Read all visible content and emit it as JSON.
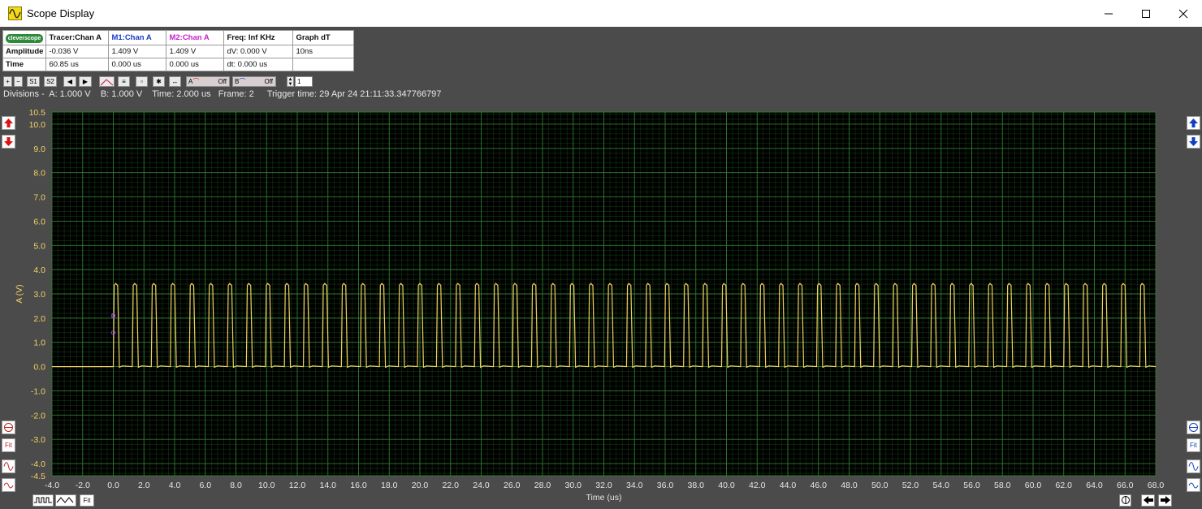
{
  "window": {
    "title": "Scope Display",
    "app_icon": "sine-wave-icon",
    "controls": [
      "minimize-icon",
      "maximize-icon",
      "close-icon"
    ]
  },
  "info_table": {
    "headers": [
      "",
      "Tracer:Chan A",
      "M1:Chan A",
      "M2:Chan A",
      "Freq: Inf KHz",
      "Graph dT"
    ],
    "header_colors": [
      "#000000",
      "#000000",
      "#1a3cc8",
      "#c81ec8",
      "#000000",
      "#000000"
    ],
    "rows": [
      [
        "Amplitude",
        "-0.036 V",
        "1.409 V",
        "1.409 V",
        "dV: 0.000 V",
        "10ns"
      ],
      [
        "Time",
        "60.85 us",
        "0.000 us",
        "0.000 us",
        "dt:  0.000 us",
        ""
      ]
    ],
    "logo_text": "cleverscope"
  },
  "toolbar": {
    "zoom_in": "+",
    "zoom_out": "−",
    "s1": "S1",
    "s2": "S2",
    "chan_a_label": "A",
    "chan_a_state": "Off",
    "chan_b_label": "B",
    "chan_b_state": "Off",
    "frame_value": "1"
  },
  "status_line": {
    "divisions": "Divisions -  A: 1.000 V    B: 1.000 V    Time: 2.000 us   Frame: 2",
    "trigger": "Trigger time: 29 Apr 24 21:11:33.347766797"
  },
  "bottom": {
    "fit_label": "Fit"
  },
  "side": {
    "fit_label": "Fit"
  },
  "colors": {
    "plot_bg": "#000000",
    "grid": "#1e5a1e",
    "trace_a": "#f0d060",
    "axis_text": "#f0d060",
    "marker": "#9040e0"
  },
  "chart_data": {
    "type": "line",
    "xlabel": "Time (us)",
    "ylabel": "A (V)",
    "xlim": [
      -4.0,
      68.0
    ],
    "ylim": [
      -4.5,
      10.5
    ],
    "x_ticks": [
      "-4.0",
      "-2.0",
      "0.0",
      "2.0",
      "4.0",
      "6.0",
      "8.0",
      "10.0",
      "12.0",
      "14.0",
      "16.0",
      "18.0",
      "20.0",
      "22.0",
      "24.0",
      "26.0",
      "28.0",
      "30.0",
      "32.0",
      "34.0",
      "36.0",
      "38.0",
      "40.0",
      "42.0",
      "44.0",
      "46.0",
      "48.0",
      "50.0",
      "52.0",
      "54.0",
      "56.0",
      "58.0",
      "60.0",
      "62.0",
      "64.0",
      "66.0",
      "68.0"
    ],
    "y_ticks": [
      "10.5",
      "10.0",
      "9.0",
      "8.0",
      "7.0",
      "6.0",
      "5.0",
      "4.0",
      "3.0",
      "2.0",
      "1.0",
      "0.0",
      "-1.0",
      "-2.0",
      "-3.0",
      "-4.0",
      "-4.5"
    ],
    "grid": true,
    "series": [
      {
        "color": "#f0d060",
        "signal": {
          "low_v": 0.0,
          "high_v": 3.35,
          "start_us": 0.0,
          "period_us": 1.24,
          "duty": 0.27,
          "end_us": 68.0
        }
      }
    ],
    "markers": [
      {
        "x": 0.0,
        "y": 2.1,
        "label": "1"
      },
      {
        "x": 0.0,
        "y": 1.4,
        "label": ""
      }
    ]
  }
}
